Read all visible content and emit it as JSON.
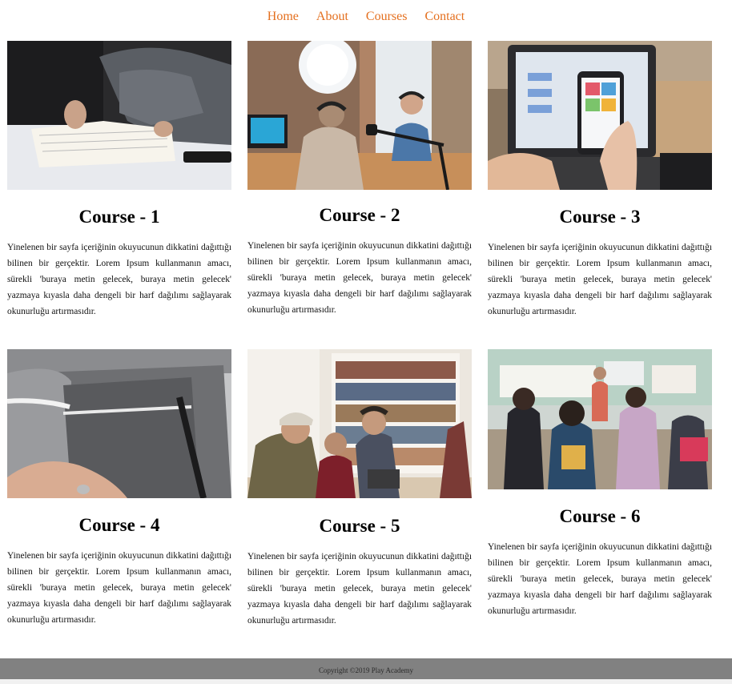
{
  "nav": {
    "items": [
      "Home",
      "About",
      "Courses",
      "Contact"
    ],
    "accent_color": "#e46f1e"
  },
  "courses": [
    {
      "title": "Course - 1",
      "description": "Yinelenen bir sayfa içeriğinin okuyucunun dikkatini dağıttığı bilinen bir gerçektir. Lorem Ipsum kullanmanın amacı, sürekli 'buraya metin gelecek, buraya metin gelecek' yazmaya kıyasla daha dengeli bir harf dağılımı sağlayarak okunurluğu artırmasıdır."
    },
    {
      "title": "Course - 2",
      "description": "Yinelenen bir sayfa içeriğinin okuyucunun dikkatini dağıttığı bilinen bir gerçektir. Lorem Ipsum kullanmanın amacı, sürekli 'buraya metin gelecek, buraya metin gelecek' yazmaya kıyasla daha dengeli bir harf dağılımı sağlayarak okunurluğu artırmasıdır."
    },
    {
      "title": "Course - 3",
      "description": "Yinelenen bir sayfa içeriğinin okuyucunun dikkatini dağıttığı bilinen bir gerçektir. Lorem Ipsum kullanmanın amacı, sürekli 'buraya metin gelecek, buraya metin gelecek' yazmaya kıyasla daha dengeli bir harf dağılımı sağlayarak okunurluğu artırmasıdır."
    },
    {
      "title": "Course - 4",
      "description": "Yinelenen bir sayfa içeriğinin okuyucunun dikkatini dağıttığı bilinen bir gerçektir. Lorem Ipsum kullanmanın amacı, sürekli 'buraya metin gelecek, buraya metin gelecek' yazmaya kıyasla daha dengeli bir harf dağılımı sağlayarak okunurluğu artırmasıdır."
    },
    {
      "title": "Course - 5",
      "description": "Yinelenen bir sayfa içeriğinin okuyucunun dikkatini dağıttığı bilinen bir gerçektir. Lorem Ipsum kullanmanın amacı, sürekli 'buraya metin gelecek, buraya metin gelecek' yazmaya kıyasla daha dengeli bir harf dağılımı sağlayarak okunurluğu artırmasıdır."
    },
    {
      "title": "Course - 6",
      "description": "Yinelenen bir sayfa içeriğinin okuyucunun dikkatini dağıttığı bilinen bir gerçektir. Lorem Ipsum kullanmanın amacı, sürekli 'buraya metin gelecek, buraya metin gelecek' yazmaya kıyasla daha dengeli bir harf dağılımı sağlayarak okunurluğu artırmasıdır."
    }
  ],
  "footer": {
    "copyright": "Copyright ©2019 Play Academy",
    "background_color": "#818181"
  }
}
